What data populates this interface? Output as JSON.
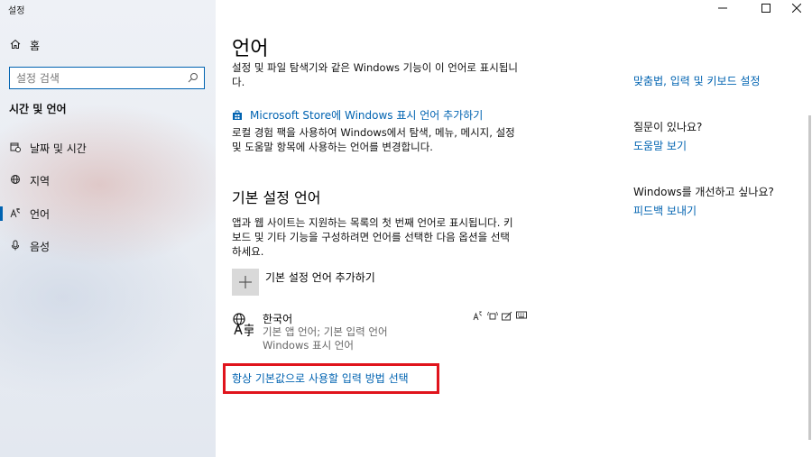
{
  "window": {
    "title": "설정",
    "minimize_icon": "minimize-icon",
    "maximize_icon": "maximize-icon",
    "close_icon": "close-icon"
  },
  "sidebar": {
    "home": {
      "label": "홈",
      "icon": "home-icon"
    },
    "search": {
      "placeholder": "설정 검색",
      "value": "",
      "icon": "search-icon"
    },
    "section_title": "시간 및 언어",
    "items": [
      {
        "label": "날짜 및 시간",
        "icon": "calendar-clock-icon",
        "selected": false
      },
      {
        "label": "지역",
        "icon": "globe-icon",
        "selected": false
      },
      {
        "label": "언어",
        "icon": "language-icon",
        "selected": true
      },
      {
        "label": "음성",
        "icon": "microphone-icon",
        "selected": false
      }
    ],
    "accent_color": "#0063b1"
  },
  "main": {
    "title": "언어",
    "intro_line1": "설정 및 파일 탐색기와 같은 Windows 기능이 이 언어로 표시됩니",
    "intro_line2": "다.",
    "store_link": "Microsoft Store에 Windows 표시 언어 추가하기",
    "store_desc_line1": "로컬 경험 팩을 사용하여 Windows에서 탐색, 메뉴, 메시지, 설정",
    "store_desc_line2": "및 도움말 항목에 사용하는 언어를 변경합니다.",
    "preferred_heading": "기본 설정 언어",
    "preferred_desc_line1": "앱과 웹 사이트는 지원하는 목록의 첫 번째 언어로 표시됩니다. 키",
    "preferred_desc_line2": "보드 및 기타 기능을 구성하려면 언어를 선택한 다음 옵션을 선택",
    "preferred_desc_line3": "하세요.",
    "add_language_label": "기본 설정 언어 추가하기",
    "language_item": {
      "name": "한국어",
      "detail_line1": "기본 앱 언어; 기본 입력 언어",
      "detail_line2": "Windows 표시 언어",
      "feature_icons": [
        "display-language-icon",
        "speech-icon",
        "handwriting-icon",
        "keyboard-icon"
      ]
    },
    "default_input_link": "항상 기본값으로 사용할 입력 방법 선택",
    "highlight_color": "#e0141c"
  },
  "related": {
    "spelling_link": "맞춤법, 입력 및 키보드 설정",
    "question": "질문이 있나요?",
    "help_link": "도움말 보기",
    "improve": "Windows를 개선하고 싶나요?",
    "feedback_link": "피드백 보내기"
  }
}
